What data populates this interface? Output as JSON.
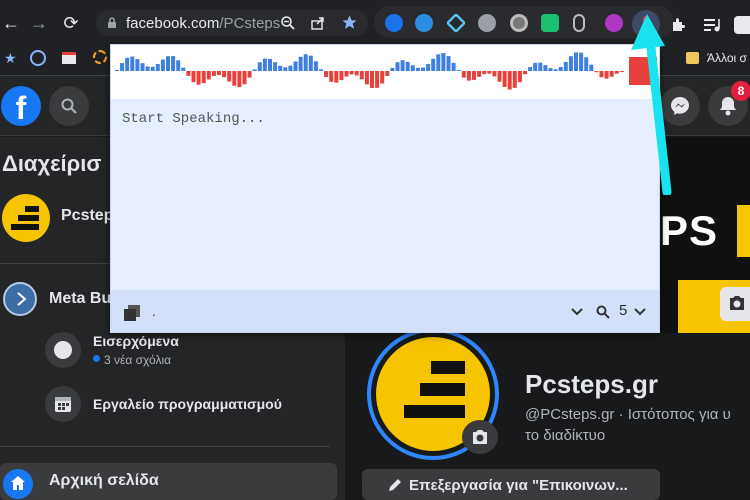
{
  "browser": {
    "url_domain": "facebook.com",
    "url_path": "/PCsteps.gr",
    "url_display_domain": "facebook.com",
    "url_display_path": "/PCsteps",
    "bookmark_folder_label": "Άλλοι σ"
  },
  "fb": {
    "notification_count": "8",
    "manage_heading": "Διαχείρισ",
    "page_name_short": "Pcsteps",
    "meta_business_label": "Meta Bu",
    "inbox_label": "Εισερχόμενα",
    "inbox_sub": "3 νέα σχόλια",
    "scheduler_label": "Εργαλείο προγραμματισμού",
    "home_label": "Αρχική σελίδα",
    "cover_text": "PS",
    "page_title": "Pcsteps.gr",
    "page_handle_line1": "@PCsteps.gr · Ιστότοπος για υ",
    "page_handle_line2": "το διαδίκτυο",
    "edit_button_label": "Επεξεργασία για \"Επικοινων..."
  },
  "popup": {
    "status_text": "Start Speaking...",
    "footer_dot": ".",
    "count_value": "5"
  },
  "colors": {
    "accent_cyan": "#19e3ee",
    "wave_positive": "#3f7fe0",
    "wave_negative": "#e8403a",
    "brand_yellow": "#f7c400",
    "fb_blue": "#1877f2"
  },
  "icons": [
    "back-arrow-icon",
    "forward-arrow-icon",
    "reload-icon",
    "lock-icon",
    "zoom-icon",
    "share-icon",
    "star-icon",
    "extension-icons",
    "mic-icon",
    "puzzle-icon",
    "media-icon",
    "search-icon",
    "messenger-icon",
    "bell-icon",
    "camera-icon",
    "pencil-icon",
    "home-icon",
    "calendar-icon",
    "chat-icon"
  ]
}
